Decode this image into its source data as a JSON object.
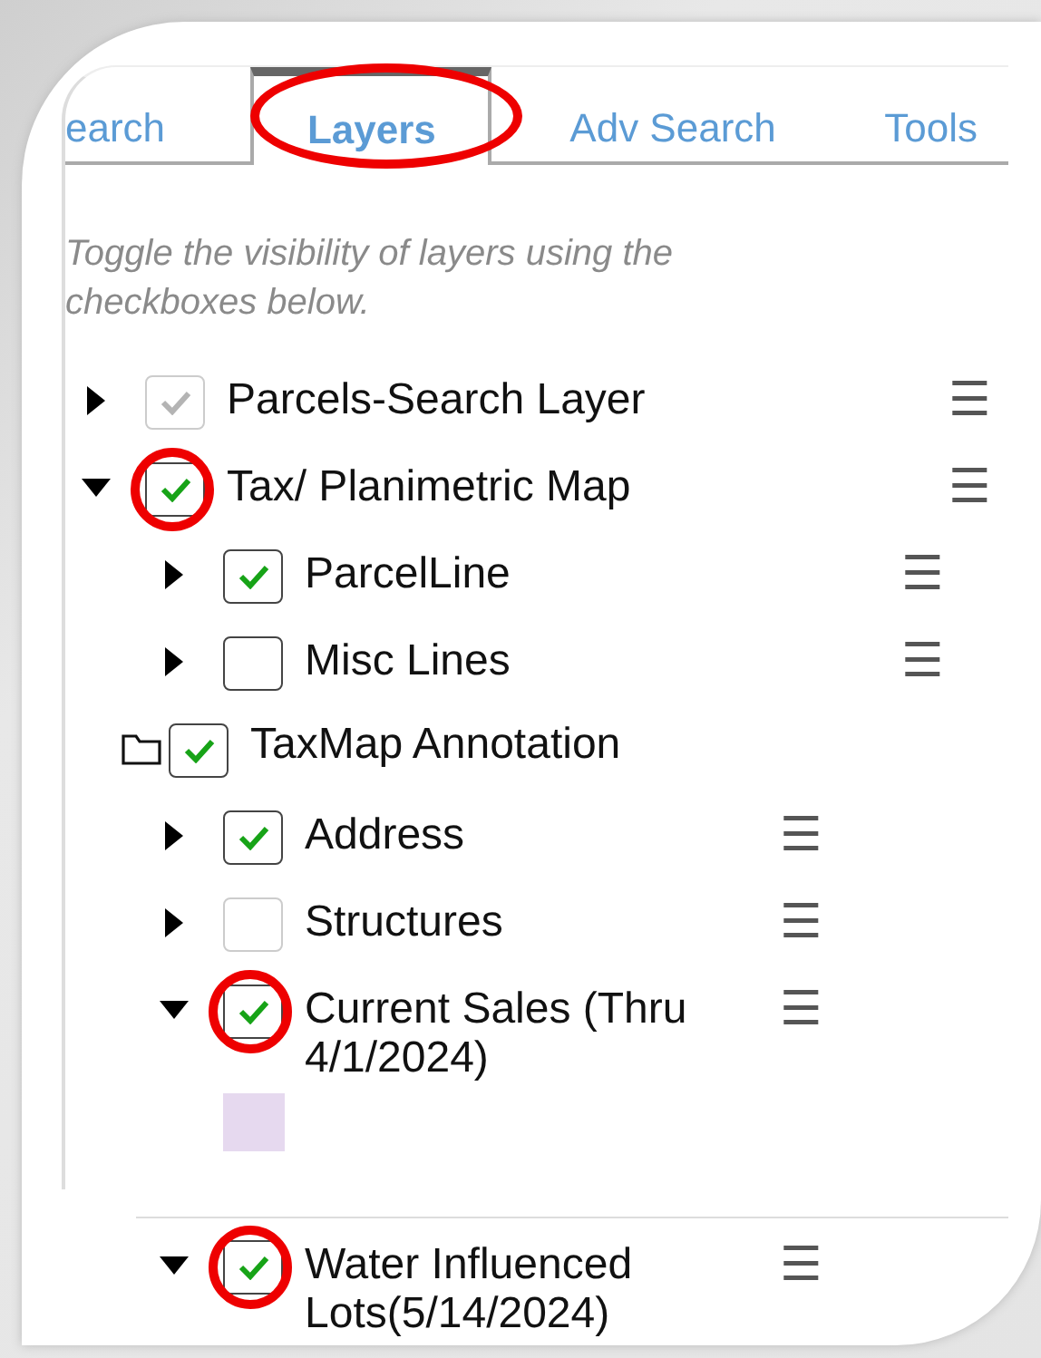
{
  "tabs": [
    {
      "label": "earch",
      "selected": false,
      "circled": false
    },
    {
      "label": "Layers",
      "selected": true,
      "circled": true
    },
    {
      "label": "Adv Search",
      "selected": false,
      "circled": false
    },
    {
      "label": "Tools",
      "selected": false,
      "circled": false
    }
  ],
  "description": "Toggle the visibility of layers using the checkboxes below.",
  "layers": [
    {
      "label": "Parcels-Search Layer",
      "kind": "layer",
      "expanded": false,
      "checked": true,
      "disabled": true,
      "circled": false,
      "menu": "☰"
    },
    {
      "label": "Tax/ Planimetric Map",
      "kind": "layer",
      "expanded": true,
      "checked": true,
      "disabled": false,
      "circled": true,
      "menu": "☰",
      "children": [
        {
          "label": "ParcelLine",
          "kind": "layer",
          "expanded": false,
          "checked": true,
          "disabled": false,
          "circled": false,
          "menu": "☰"
        },
        {
          "label": "Misc Lines",
          "kind": "layer",
          "expanded": false,
          "checked": false,
          "disabled": false,
          "circled": false,
          "menu": "☰"
        },
        {
          "label": "TaxMap Annotation",
          "kind": "folder",
          "checked": true,
          "disabled": false,
          "circled": false,
          "children": [
            {
              "label": "Address",
              "kind": "layer",
              "expanded": false,
              "checked": true,
              "disabled": false,
              "circled": false,
              "menu": "☰"
            },
            {
              "label": "Structures",
              "kind": "layer",
              "expanded": false,
              "checked": false,
              "disabled": true,
              "circled": false,
              "menu": "☰"
            },
            {
              "label": "Current Sales (Thru 4/1/2024)",
              "kind": "layer",
              "expanded": true,
              "checked": true,
              "disabled": false,
              "circled": true,
              "menu": "☰",
              "legend": {
                "color": "#e6d9ef"
              }
            },
            {
              "label": "Water Influenced Lots(5/14/2024)",
              "kind": "layer",
              "expanded": true,
              "checked": true,
              "disabled": false,
              "circled": true,
              "menu": "☰"
            }
          ]
        }
      ]
    }
  ]
}
